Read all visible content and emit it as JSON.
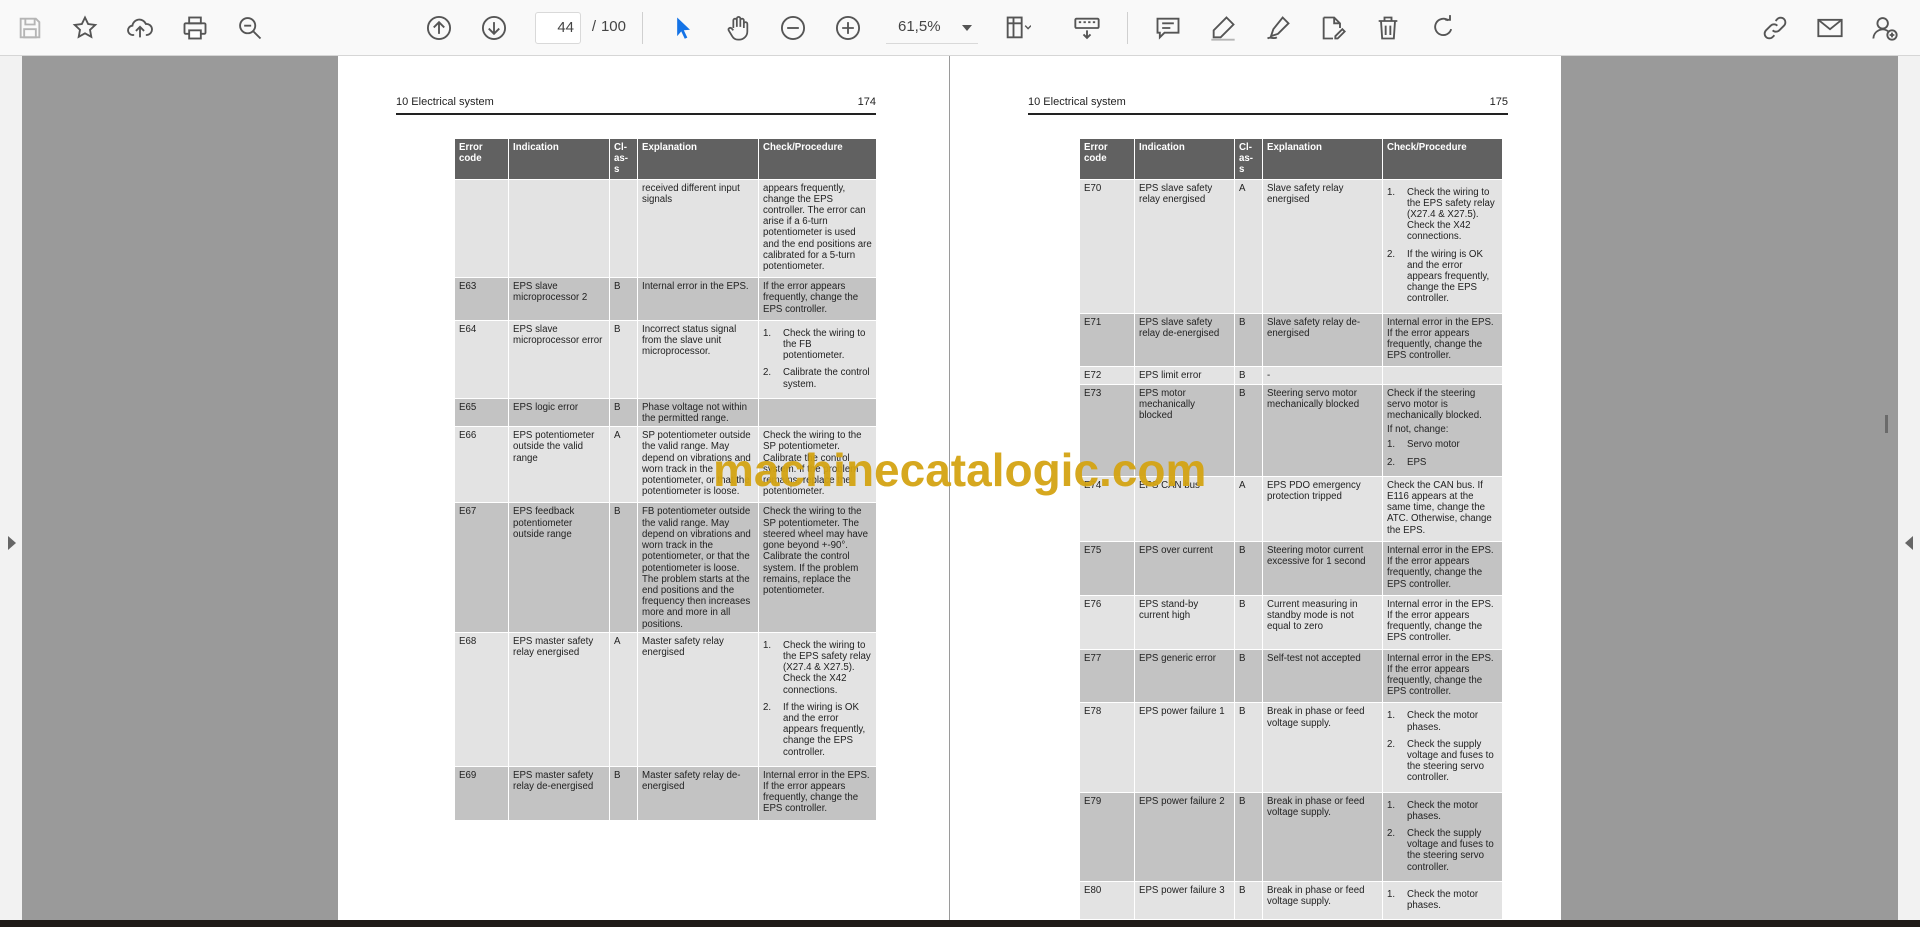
{
  "toolbar": {
    "page_current": "44",
    "page_separator": "/",
    "page_total": "100",
    "zoom": "61,5%",
    "icons": [
      "save-icon",
      "bookmark-star-icon",
      "upload-cloud-icon",
      "print-icon",
      "zoom-search-icon",
      "previous-page-icon",
      "next-page-icon",
      "select-cursor-icon",
      "hand-pan-icon",
      "zoom-out-icon",
      "zoom-in-icon",
      "page-fit-icon",
      "keyboard-icon",
      "comment-icon",
      "highlight-pen-icon",
      "draw-pen-icon",
      "edit-sign-icon",
      "delete-trash-icon",
      "rotate-icon",
      "link-icon",
      "email-icon",
      "add-user-icon"
    ]
  },
  "watermark": "machinecatalogic.com",
  "left_page": {
    "section": "10 Electrical system",
    "page_number": "174",
    "headers": [
      "Error code",
      "Indication",
      "Cl-as-s",
      "Explanation",
      "Check/Procedure"
    ],
    "rows": [
      {
        "code": "",
        "indication": "",
        "class": "",
        "explanation": "received different input signals",
        "check": [
          "appears frequently, change the EPS controller. The error can arise if a 6-turn potentiometer is used and the end positions are calibrated for a 5-turn potentiometer."
        ],
        "steps": []
      },
      {
        "code": "E63",
        "indication": "EPS slave microprocessor 2",
        "class": "B",
        "explanation": "Internal error in the EPS.",
        "check": [
          "If the error appears frequently, change the EPS controller."
        ],
        "steps": []
      },
      {
        "code": "E64",
        "indication": "EPS slave microprocessor error",
        "class": "B",
        "explanation": "Incorrect status signal from the slave unit microprocessor.",
        "check": [],
        "steps": [
          {
            "n": "1.",
            "t": "Check the wiring to the FB potentiometer."
          },
          {
            "n": "2.",
            "t": "Calibrate the control system."
          }
        ]
      },
      {
        "code": "E65",
        "indication": "EPS logic error",
        "class": "B",
        "explanation": "Phase voltage not within the permitted range.",
        "check": [],
        "steps": []
      },
      {
        "code": "E66",
        "indication": "EPS potentiometer outside the valid range",
        "class": "A",
        "explanation": "SP potentiometer outside the valid range. May depend on vibrations and worn track in the potentiometer, or that the potentiometer is loose.",
        "check": [
          "Check the wiring to the SP potentiometer. Calibrate the control system. If the problem remains, replace the potentiometer."
        ],
        "steps": []
      },
      {
        "code": "E67",
        "indication": "EPS feedback potentiometer outside range",
        "class": "B",
        "explanation": "FB potentiometer outside the valid range. May depend on vibrations and worn track in the potentiometer, or that the potentiometer is loose. The problem starts at the end positions and the frequency then increases more and more in all positions.",
        "check": [
          "Check the wiring to the SP potentiometer. The steered wheel may have gone beyond +-90°. Calibrate the control system. If the problem remains, replace the potentiometer."
        ],
        "steps": []
      },
      {
        "code": "E68",
        "indication": "EPS master safety relay energised",
        "class": "A",
        "explanation": "Master safety relay energised",
        "check": [],
        "steps": [
          {
            "n": "1.",
            "t": "Check the wiring to the EPS safety relay (X27.4 & X27.5). Check the X42 connections."
          },
          {
            "n": "2.",
            "t": "If the wiring is OK and the error appears frequently, change the EPS controller."
          }
        ]
      },
      {
        "code": "E69",
        "indication": "EPS master safety relay de-energised",
        "class": "B",
        "explanation": "Master safety relay de-energised",
        "check": [
          "Internal error in the EPS. If the error appears frequently, change the EPS controller."
        ],
        "steps": []
      }
    ]
  },
  "right_page": {
    "section": "10 Electrical system",
    "page_number": "175",
    "headers": [
      "Error code",
      "Indication",
      "Cl-as-s",
      "Explanation",
      "Check/Procedure"
    ],
    "rows": [
      {
        "code": "E70",
        "indication": "EPS slave safety relay energised",
        "class": "A",
        "explanation": "Slave safety relay energised",
        "check": [],
        "steps": [
          {
            "n": "1.",
            "t": "Check the wiring to the EPS safety relay (X27.4 & X27.5). Check the X42 connections."
          },
          {
            "n": "2.",
            "t": "If the wiring is OK and the error appears frequently, change the EPS controller."
          }
        ]
      },
      {
        "code": "E71",
        "indication": "EPS slave safety relay de-energised",
        "class": "B",
        "explanation": "Slave safety relay de-energised",
        "check": [
          "Internal error in the EPS. If the error appears frequently, change the EPS controller."
        ],
        "steps": []
      },
      {
        "code": "E72",
        "indication": "EPS limit error",
        "class": "B",
        "explanation": "-",
        "check": [],
        "steps": []
      },
      {
        "code": "E73",
        "indication": "EPS motor mechanically blocked",
        "class": "B",
        "explanation": "Steering servo motor mechanically blocked",
        "check": [
          "Check if the steering servo motor is mechanically blocked.",
          "If not, change:"
        ],
        "steps": [
          {
            "n": "1.",
            "t": "Servo motor"
          },
          {
            "n": "2.",
            "t": "EPS"
          }
        ]
      },
      {
        "code": "E74",
        "indication": "EPS CAN bus",
        "class": "A",
        "explanation": "EPS PDO emergency protection tripped",
        "check": [
          "Check the CAN bus. If E116 appears at the same time, change the ATC. Otherwise, change the EPS."
        ],
        "steps": []
      },
      {
        "code": "E75",
        "indication": "EPS over current",
        "class": "B",
        "explanation": "Steering motor current excessive for 1 second",
        "check": [
          "Internal error in the EPS. If the error appears frequently, change the EPS controller."
        ],
        "steps": []
      },
      {
        "code": "E76",
        "indication": "EPS stand-by current high",
        "class": "B",
        "explanation": "Current measuring in standby mode is not equal to zero",
        "check": [
          "Internal error in the EPS. If the error appears frequently, change the EPS controller."
        ],
        "steps": []
      },
      {
        "code": "E77",
        "indication": "EPS generic error",
        "class": "B",
        "explanation": "Self-test not accepted",
        "check": [
          "Internal error in the EPS. If the error appears frequently, change the EPS controller."
        ],
        "steps": []
      },
      {
        "code": "E78",
        "indication": "EPS power failure 1",
        "class": "B",
        "explanation": "Break in phase or feed voltage supply.",
        "check": [],
        "steps": [
          {
            "n": "1.",
            "t": "Check the motor phases."
          },
          {
            "n": "2.",
            "t": "Check the supply voltage and fuses to the steering servo controller."
          }
        ]
      },
      {
        "code": "E79",
        "indication": "EPS power failure 2",
        "class": "B",
        "explanation": "Break in phase or feed voltage supply.",
        "check": [],
        "steps": [
          {
            "n": "1.",
            "t": "Check the motor phases."
          },
          {
            "n": "2.",
            "t": "Check the supply voltage and fuses to the steering servo controller."
          }
        ]
      },
      {
        "code": "E80",
        "indication": "EPS power failure 3",
        "class": "B",
        "explanation": "Break in phase or feed voltage supply.",
        "check": [],
        "steps": [
          {
            "n": "1.",
            "t": "Check the motor phases."
          }
        ]
      }
    ]
  }
}
